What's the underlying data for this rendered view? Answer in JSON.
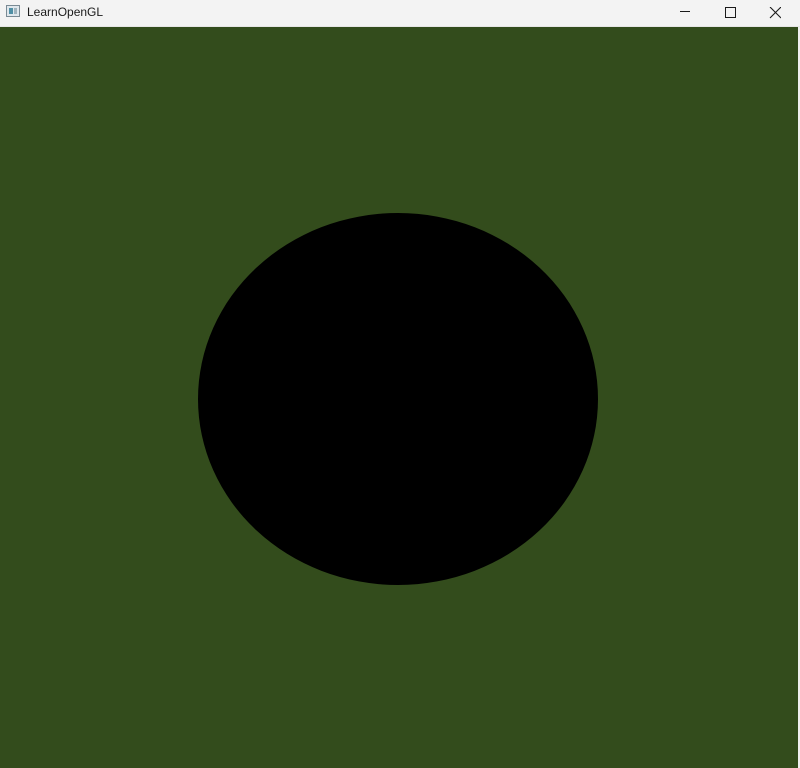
{
  "window": {
    "title": "LearnOpenGL",
    "controls": {
      "minimize_icon": "minimize-icon",
      "maximize_icon": "maximize-icon",
      "close_icon": "close-icon"
    }
  },
  "scene": {
    "clear_color": "#334c1c",
    "shape": "circle",
    "shape_color": "#000000"
  }
}
